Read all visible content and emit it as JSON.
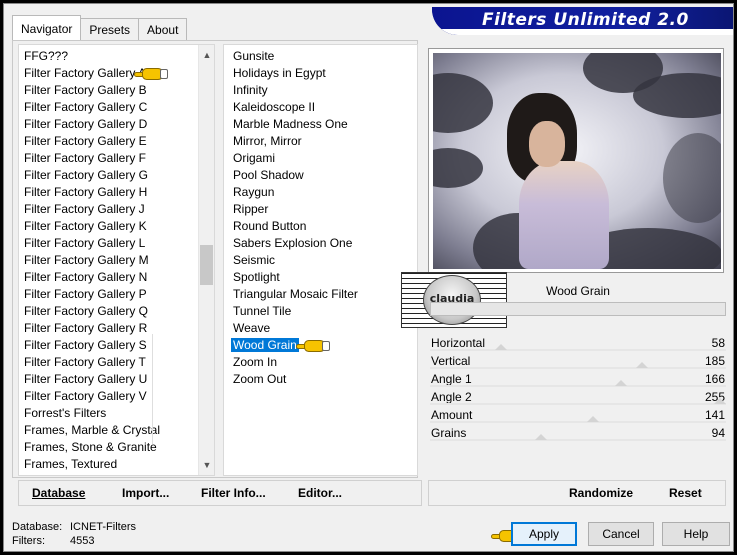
{
  "app": {
    "title": "Filters Unlimited 2.0"
  },
  "tabs": [
    {
      "label": "Navigator",
      "active": true
    },
    {
      "label": "Presets",
      "active": false
    },
    {
      "label": "About",
      "active": false
    }
  ],
  "categories": [
    "FFG???",
    "Filter Factory Gallery A",
    "Filter Factory Gallery B",
    "Filter Factory Gallery C",
    "Filter Factory Gallery D",
    "Filter Factory Gallery E",
    "Filter Factory Gallery F",
    "Filter Factory Gallery G",
    "Filter Factory Gallery H",
    "Filter Factory Gallery J",
    "Filter Factory Gallery K",
    "Filter Factory Gallery L",
    "Filter Factory Gallery M",
    "Filter Factory Gallery N",
    "Filter Factory Gallery P",
    "Filter Factory Gallery Q",
    "Filter Factory Gallery R",
    "Filter Factory Gallery S",
    "Filter Factory Gallery T",
    "Filter Factory Gallery U",
    "Filter Factory Gallery V",
    "Forrest's Filters",
    "Frames, Marble & Crystal",
    "Frames, Stone & Granite",
    "Frames, Textured"
  ],
  "filters": [
    "Gunsite",
    "Holidays in Egypt",
    "Infinity",
    "Kaleidoscope II",
    "Marble Madness One",
    "Mirror, Mirror",
    "Origami",
    "Pool Shadow",
    "Raygun",
    "Ripper",
    "Round Button",
    "Sabers Explosion One",
    "Seismic",
    "Spotlight",
    "Triangular Mosaic Filter",
    "Tunnel Tile",
    "Weave",
    "Wood Grain",
    "Zoom In",
    "Zoom Out"
  ],
  "selected_filter": "Wood Grain",
  "preview": {
    "watermark": "claudia"
  },
  "params": [
    {
      "label": "Horizontal",
      "value": "58",
      "level": 58
    },
    {
      "label": "Vertical",
      "value": "185",
      "level": 185
    },
    {
      "label": "Angle 1",
      "value": "166",
      "level": 166
    },
    {
      "label": "Angle 2",
      "value": "255",
      "level": 255
    },
    {
      "label": "Amount",
      "value": "141",
      "level": 141
    },
    {
      "label": "Grains",
      "value": "94",
      "level": 94
    }
  ],
  "toolbar": {
    "database": "Database",
    "import": "Import...",
    "filter_info": "Filter Info...",
    "editor": "Editor...",
    "randomize": "Randomize",
    "reset": "Reset"
  },
  "status": {
    "database_label": "Database:",
    "database_value": "ICNET-Filters",
    "filters_label": "Filters:",
    "filters_value": "4553"
  },
  "buttons": {
    "apply": "Apply",
    "cancel": "Cancel",
    "help": "Help"
  },
  "colors": {
    "banner": "#0b1490",
    "selection": "#0078d7",
    "pointer": "#f6c300"
  }
}
